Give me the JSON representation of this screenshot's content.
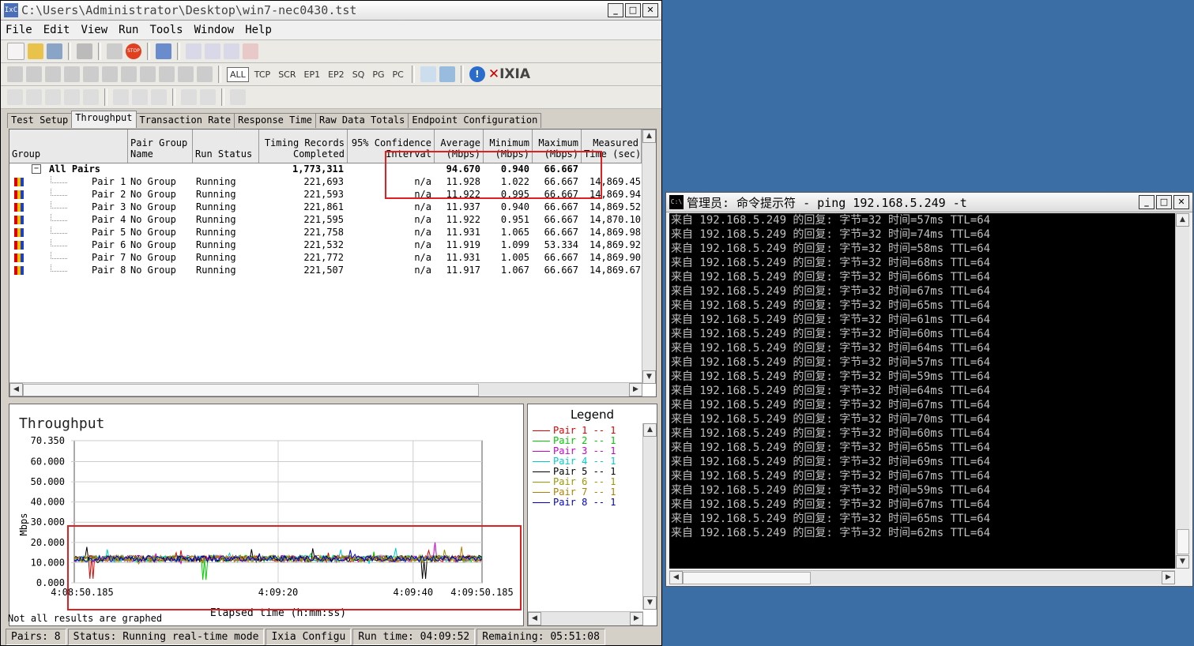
{
  "ixia": {
    "title": "C:\\Users\\Administrator\\Desktop\\win7-nec0430.tst",
    "menu": [
      "File",
      "Edit",
      "View",
      "Run",
      "Tools",
      "Window",
      "Help"
    ],
    "filters": [
      "ALL",
      "TCP",
      "SCR",
      "EP1",
      "EP2",
      "SQ",
      "PG",
      "PC"
    ],
    "logo": "IXIA",
    "tabs": [
      "Test Setup",
      "Throughput",
      "Transaction Rate",
      "Response Time",
      "Raw Data Totals",
      "Endpoint Configuration"
    ],
    "active_tab": "Throughput",
    "columns": {
      "group": "Group",
      "pair_group_name": "Pair Group\nName",
      "run_status": "Run Status",
      "timing_records": "Timing Records\nCompleted",
      "confidence": "95% Confidence\nInterval",
      "average": "Average\n(Mbps)",
      "minimum": "Minimum\n(Mbps)",
      "maximum": "Maximum\n(Mbps)",
      "measured": "Measured\nTime (sec)"
    },
    "all_pairs": {
      "label": "All Pairs",
      "records": "1,773,311",
      "average": "94.670",
      "minimum": "0.940",
      "maximum": "66.667"
    },
    "rows": [
      {
        "pair": "Pair 1",
        "group": "No Group",
        "status": "Running",
        "records": "221,693",
        "ci": "n/a",
        "avg": "11.928",
        "min": "1.022",
        "max": "66.667",
        "time": "14,869.45"
      },
      {
        "pair": "Pair 2",
        "group": "No Group",
        "status": "Running",
        "records": "221,593",
        "ci": "n/a",
        "avg": "11.922",
        "min": "0.995",
        "max": "66.667",
        "time": "14,869.94"
      },
      {
        "pair": "Pair 3",
        "group": "No Group",
        "status": "Running",
        "records": "221,861",
        "ci": "n/a",
        "avg": "11.937",
        "min": "0.940",
        "max": "66.667",
        "time": "14,869.52"
      },
      {
        "pair": "Pair 4",
        "group": "No Group",
        "status": "Running",
        "records": "221,595",
        "ci": "n/a",
        "avg": "11.922",
        "min": "0.951",
        "max": "66.667",
        "time": "14,870.10"
      },
      {
        "pair": "Pair 5",
        "group": "No Group",
        "status": "Running",
        "records": "221,758",
        "ci": "n/a",
        "avg": "11.931",
        "min": "1.065",
        "max": "66.667",
        "time": "14,869.98"
      },
      {
        "pair": "Pair 6",
        "group": "No Group",
        "status": "Running",
        "records": "221,532",
        "ci": "n/a",
        "avg": "11.919",
        "min": "1.099",
        "max": "53.334",
        "time": "14,869.92"
      },
      {
        "pair": "Pair 7",
        "group": "No Group",
        "status": "Running",
        "records": "221,772",
        "ci": "n/a",
        "avg": "11.931",
        "min": "1.005",
        "max": "66.667",
        "time": "14,869.90"
      },
      {
        "pair": "Pair 8",
        "group": "No Group",
        "status": "Running",
        "records": "221,507",
        "ci": "n/a",
        "avg": "11.917",
        "min": "1.067",
        "max": "66.667",
        "time": "14,869.67"
      }
    ],
    "status": {
      "pairs": "Pairs: 8",
      "status": "Status: Running real-time mode",
      "config": "Ixia Configu",
      "runtime": "Run time: 04:09:52",
      "remaining": "Remaining: 05:51:08"
    },
    "note": "Not all results are graphed"
  },
  "chart_data": {
    "type": "line",
    "title": "Throughput",
    "ylabel": "Mbps",
    "xlabel": "Elapsed time (h:mm:ss)",
    "ylim": [
      0,
      70.35
    ],
    "yticks": [
      "70.350",
      "60.000",
      "50.000",
      "40.000",
      "30.000",
      "20.000",
      "10.000",
      "0.000"
    ],
    "xticks": [
      "4:08:50.185",
      "4:09:20",
      "4:09:40",
      "4:09:50.185"
    ],
    "baseline": 12,
    "series": [
      {
        "name": "Pair 1 -- 1",
        "color": "#e00000"
      },
      {
        "name": "Pair 2 -- 1",
        "color": "#00cc00"
      },
      {
        "name": "Pair 3 -- 1",
        "color": "#cc00cc"
      },
      {
        "name": "Pair 4 -- 1",
        "color": "#00cccc"
      },
      {
        "name": "Pair 5 -- 1",
        "color": "#000000"
      },
      {
        "name": "Pair 6 -- 1",
        "color": "#999900"
      },
      {
        "name": "Pair 7 -- 1",
        "color": "#b08000"
      },
      {
        "name": "Pair 8 -- 1",
        "color": "#0000cc"
      }
    ]
  },
  "legend_title": "Legend",
  "cmd": {
    "title": "管理员: 命令提示符 - ping  192.168.5.249 -t",
    "lines": [
      "来自 192.168.5.249 的回复: 字节=32 时间=57ms TTL=64",
      "来自 192.168.5.249 的回复: 字节=32 时间=74ms TTL=64",
      "来自 192.168.5.249 的回复: 字节=32 时间=58ms TTL=64",
      "来自 192.168.5.249 的回复: 字节=32 时间=68ms TTL=64",
      "来自 192.168.5.249 的回复: 字节=32 时间=66ms TTL=64",
      "来自 192.168.5.249 的回复: 字节=32 时间=67ms TTL=64",
      "来自 192.168.5.249 的回复: 字节=32 时间=65ms TTL=64",
      "来自 192.168.5.249 的回复: 字节=32 时间=61ms TTL=64",
      "来自 192.168.5.249 的回复: 字节=32 时间=60ms TTL=64",
      "来自 192.168.5.249 的回复: 字节=32 时间=64ms TTL=64",
      "来自 192.168.5.249 的回复: 字节=32 时间=57ms TTL=64",
      "来自 192.168.5.249 的回复: 字节=32 时间=59ms TTL=64",
      "来自 192.168.5.249 的回复: 字节=32 时间=64ms TTL=64",
      "来自 192.168.5.249 的回复: 字节=32 时间=67ms TTL=64",
      "来自 192.168.5.249 的回复: 字节=32 时间=70ms TTL=64",
      "来自 192.168.5.249 的回复: 字节=32 时间=60ms TTL=64",
      "来自 192.168.5.249 的回复: 字节=32 时间=65ms TTL=64",
      "来自 192.168.5.249 的回复: 字节=32 时间=69ms TTL=64",
      "来自 192.168.5.249 的回复: 字节=32 时间=67ms TTL=64",
      "来自 192.168.5.249 的回复: 字节=32 时间=59ms TTL=64",
      "来自 192.168.5.249 的回复: 字节=32 时间=67ms TTL=64",
      "来自 192.168.5.249 的回复: 字节=32 时间=65ms TTL=64",
      "来自 192.168.5.249 的回复: 字节=32 时间=62ms TTL=64"
    ]
  }
}
